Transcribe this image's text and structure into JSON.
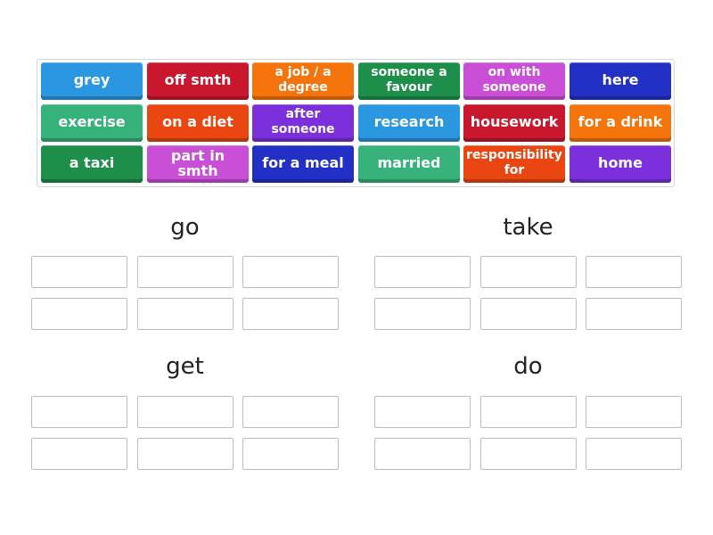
{
  "tiles": [
    {
      "label": "grey",
      "color": "#2a97e0"
    },
    {
      "label": "off smth",
      "color": "#c9182e"
    },
    {
      "label": "a job / a degree",
      "color": "#f5740c"
    },
    {
      "label": "someone a favour",
      "color": "#1d8f4a"
    },
    {
      "label": "on with someone",
      "color": "#c94fd6"
    },
    {
      "label": "here",
      "color": "#2230c6"
    },
    {
      "label": "exercise",
      "color": "#37b27a"
    },
    {
      "label": "on a diet",
      "color": "#ea4612"
    },
    {
      "label": "after someone",
      "color": "#7c30dc"
    },
    {
      "label": "research",
      "color": "#2a97e0"
    },
    {
      "label": "housework",
      "color": "#c9182e"
    },
    {
      "label": "for a drink",
      "color": "#f5740c"
    },
    {
      "label": "a taxi",
      "color": "#1d8f4a"
    },
    {
      "label": "part in smth",
      "color": "#c94fd6"
    },
    {
      "label": "for a meal",
      "color": "#2230c6"
    },
    {
      "label": "married",
      "color": "#37b27a"
    },
    {
      "label": "responsibility for",
      "color": "#ea4612"
    },
    {
      "label": "home",
      "color": "#7c30dc"
    }
  ],
  "groups": [
    {
      "title": "go",
      "slots": 6
    },
    {
      "title": "take",
      "slots": 6
    },
    {
      "title": "get",
      "slots": 6
    },
    {
      "title": "do",
      "slots": 6
    }
  ]
}
